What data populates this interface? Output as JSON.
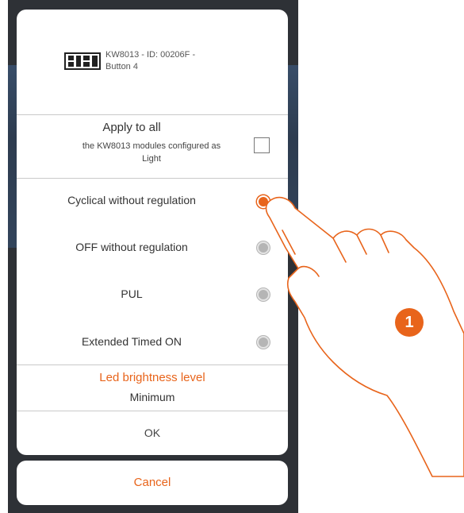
{
  "device": {
    "line1": "KW8013 - ID: 00206F -",
    "line2": "Button 4",
    "icon": "module-icon"
  },
  "apply_all": {
    "title": "Apply to all",
    "subtitle_line1": "the KW8013 modules configured as",
    "subtitle_line2": "Light",
    "checked": false
  },
  "options": [
    {
      "label": "Cyclical without regulation",
      "selected": true
    },
    {
      "label": "OFF without regulation",
      "selected": false
    },
    {
      "label": "PUL",
      "selected": false
    },
    {
      "label": "Extended Timed ON",
      "selected": false
    }
  ],
  "led": {
    "title": "Led brightness level",
    "value": "Minimum"
  },
  "buttons": {
    "ok": "OK",
    "cancel": "Cancel"
  },
  "step_marker": "1",
  "colors": {
    "accent": "#e8641b",
    "backdrop": "#2e3136"
  }
}
